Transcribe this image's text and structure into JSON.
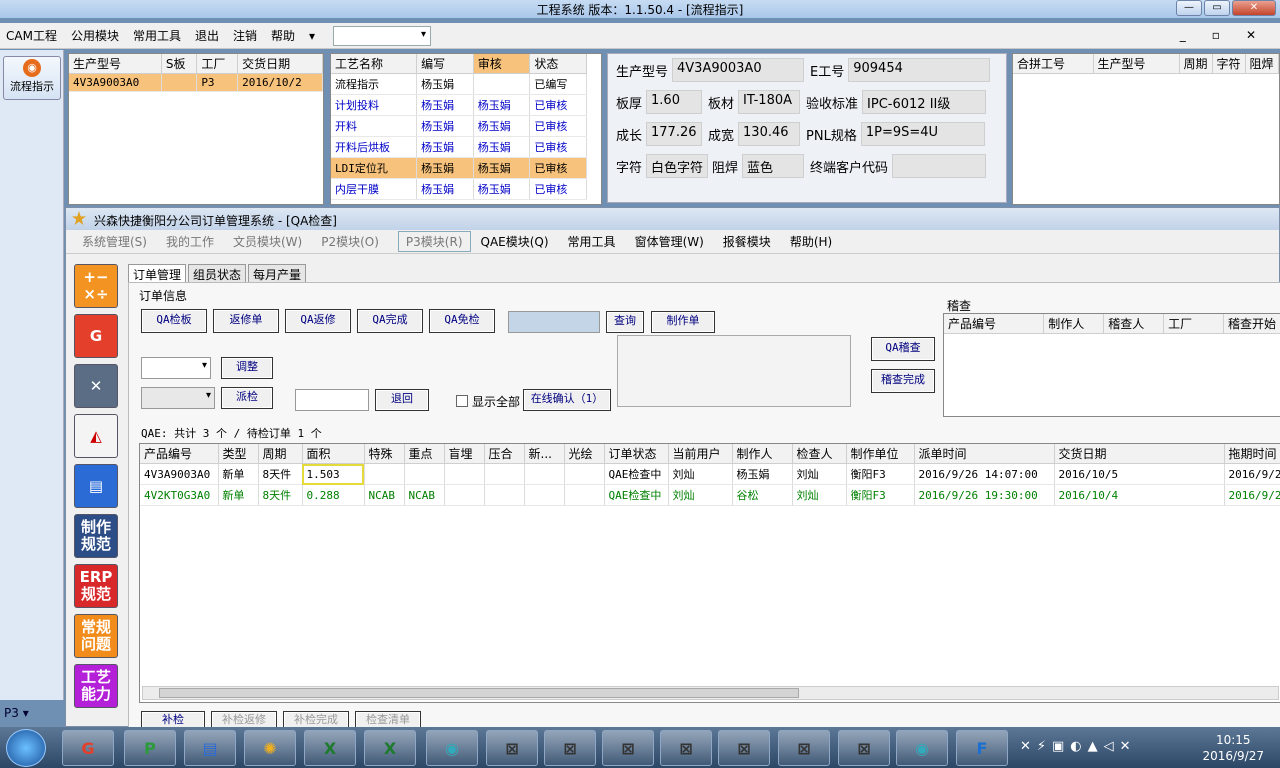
{
  "outer": {
    "title": "工程系统  版本：1.1.50.4 - [流程指示]",
    "menu": [
      "CAM工程",
      "公用模块",
      "常用工具",
      "退出",
      "注销",
      "帮助"
    ],
    "menu_dropdown": "▾",
    "flow_button": "流程指示",
    "right_controls": [
      "_",
      "▫",
      "✕"
    ]
  },
  "order_grid": {
    "headers": [
      "生产型号",
      "S板",
      "工厂",
      "交货日期"
    ],
    "rows": [
      [
        "4V3A9003A0",
        "",
        "P3",
        "2016/10/2"
      ]
    ]
  },
  "process_grid": {
    "headers": [
      "工艺名称",
      "编写",
      "审核",
      "状态"
    ],
    "rows": [
      [
        "流程指示",
        "杨玉娟",
        "",
        "已编写"
      ],
      [
        "计划投料",
        "杨玉娟",
        "杨玉娟",
        "已审核"
      ],
      [
        "开料",
        "杨玉娟",
        "杨玉娟",
        "已审核"
      ],
      [
        "开料后烘板",
        "杨玉娟",
        "杨玉娟",
        "已审核"
      ],
      [
        "LDI定位孔",
        "杨玉娟",
        "杨玉娟",
        "已审核"
      ],
      [
        "内层干膜",
        "杨玉娟",
        "杨玉娟",
        "已审核"
      ]
    ]
  },
  "info": {
    "prod_model_label": "生产型号",
    "prod_model": "4V3A9003A0",
    "e_no_label": "E工号",
    "e_no": "909454",
    "thickness_label": "板厚",
    "thickness": "1.60",
    "material_label": "板材",
    "material": "IT-180A",
    "standard_label": "验收标准",
    "standard": "IPC-6012 II级",
    "len_label": "成长",
    "len": "177.26",
    "wid_label": "成宽",
    "wid": "130.46",
    "pnl_label": "PNL规格",
    "pnl": "1P=9S=4U",
    "char_label": "字符",
    "char": "白色字符",
    "mask_label": "阻焊",
    "mask": "蓝色",
    "customer_label": "终端客户代码",
    "customer": ""
  },
  "merge_grid": {
    "headers": [
      "合拼工号",
      "生产型号",
      "周期",
      "字符",
      "阻焊"
    ]
  },
  "left_combo": "P3",
  "child": {
    "title": "兴森快捷衡阳分公司订单管理系统 - [QA检查]",
    "menu": [
      "系统管理(S)",
      "我的工作",
      "文员模块(W)",
      "P2模块(O)",
      "P3模块(R)",
      "QAE模块(Q)",
      "常用工具",
      "窗体管理(W)",
      "报餐模块",
      "帮助(H)"
    ],
    "icons": [
      "制作规范",
      "ERP规范",
      "常规问题",
      "工艺能力"
    ],
    "tabs": [
      "订单管理",
      "组员状态",
      "每月产量"
    ],
    "group_label": "订单信息",
    "buttons": {
      "qa_check": "QA检板",
      "rework": "返修单",
      "qa_rework": "QA返修",
      "qa_done": "QA完成",
      "qa_exempt": "QA免检",
      "query": "查询",
      "make": "制作单",
      "adjust": "调整",
      "dispatch": "派检",
      "return": "退回",
      "show_all": "显示全部",
      "online_confirm": "在线确认（1）",
      "qa_audit": "QA稽查",
      "audit_done": "稽查完成"
    },
    "audit_label": "稽查",
    "audit_headers": [
      "产品编号",
      "制作人",
      "稽查人",
      "工厂",
      "稽查开始"
    ],
    "summary": "QAE: 共计 3 个 / 待检订单 1 个",
    "grid_headers": [
      "产品编号",
      "类型",
      "周期",
      "面积",
      "特殊",
      "重点",
      "盲埋",
      "压合",
      "新...",
      "光绘",
      "订单状态",
      "当前用户",
      "制作人",
      "检查人",
      "制作单位",
      "派单时间",
      "交货日期",
      "拖期时间"
    ],
    "rows": [
      [
        "4V3A9003A0",
        "新单",
        "8天件",
        "1.503",
        "",
        "",
        "",
        "",
        "",
        "",
        "QAE检查中",
        "刘灿",
        "杨玉娟",
        "刘灿",
        "衡阳F3",
        "2016/9/26 14:07:00",
        "2016/10/5",
        "2016/9/2"
      ],
      [
        "4V2KT0G3A0",
        "新单",
        "8天件",
        "0.288",
        "NCAB",
        "NCAB",
        "",
        "",
        "",
        "",
        "QAE检查中",
        "刘灿",
        "谷松",
        "刘灿",
        "衡阳F3",
        "2016/9/26 19:30:00",
        "2016/10/4",
        "2016/9/2"
      ]
    ],
    "bottom_buttons": [
      "补检",
      "补检返修",
      "补检完成",
      "检查清单"
    ]
  },
  "taskbar": {
    "time": "10:15",
    "date": "2016/9/27"
  },
  "colors": {
    "highlight": "#f7c27b",
    "green_row": "#008000",
    "title_blue": "#0000c8"
  }
}
